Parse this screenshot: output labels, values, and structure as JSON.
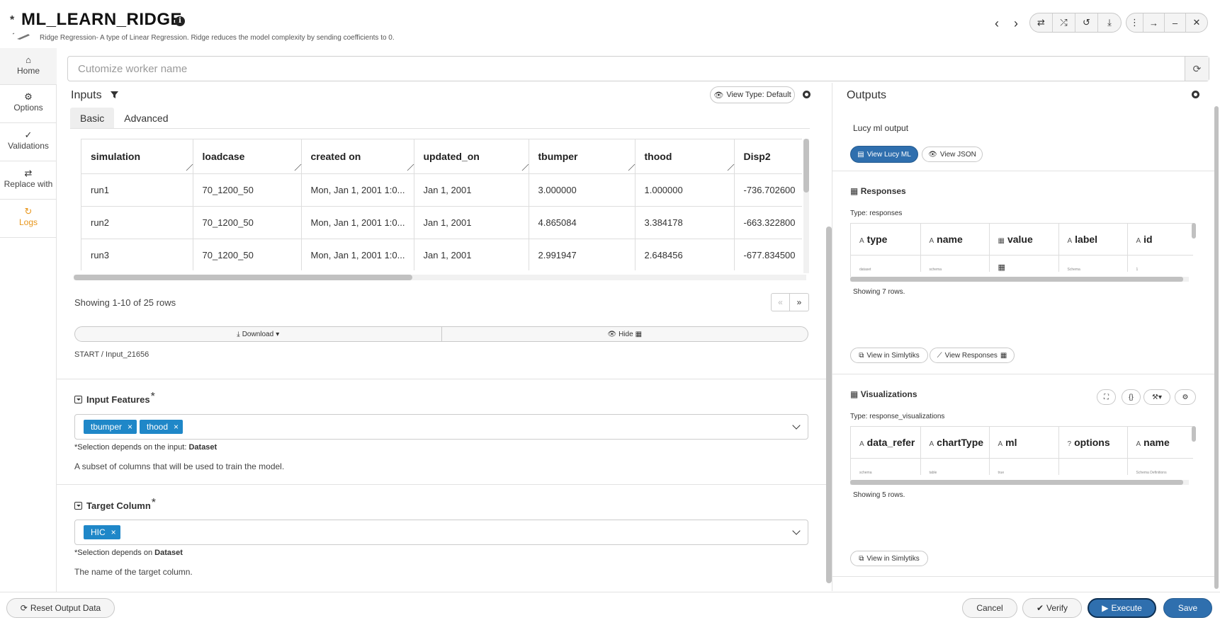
{
  "header": {
    "modified_marker": "*",
    "title": "ML_LEARN_RIDGE",
    "subtitle": "Ridge Regression- A type of Linear Regression. Ridge reduces the model complexity by sending coefficients to 0."
  },
  "sidebar": {
    "items": [
      {
        "label": "Home",
        "icon": "home-icon"
      },
      {
        "label": "Options",
        "icon": "gear-icon"
      },
      {
        "label": "Validations",
        "icon": "check-icon"
      },
      {
        "label": "Replace with",
        "icon": "swap-icon"
      },
      {
        "label": "Logs",
        "icon": "history-icon",
        "color": "#e8961c"
      }
    ]
  },
  "worker": {
    "placeholder": "Cutomize worker name",
    "value": ""
  },
  "inputs": {
    "title": "Inputs",
    "view_type": "View Type: Default",
    "tabs": [
      "Basic",
      "Advanced"
    ],
    "table": {
      "columns": [
        "simulation",
        "loadcase",
        "created on",
        "updated_on",
        "tbumper",
        "thood",
        "Disp2"
      ],
      "rows": [
        [
          "run1",
          "70_1200_50",
          "Mon, Jan 1, 2001 1:0...",
          "Jan 1, 2001",
          "3.000000",
          "1.000000",
          "-736.702600"
        ],
        [
          "run2",
          "70_1200_50",
          "Mon, Jan 1, 2001 1:0...",
          "Jan 1, 2001",
          "4.865084",
          "3.384178",
          "-663.322800"
        ],
        [
          "run3",
          "70_1200_50",
          "Mon, Jan 1, 2001 1:0...",
          "Jan 1, 2001",
          "2.991947",
          "2.648456",
          "-677.834500"
        ]
      ]
    },
    "showing": "Showing 1-10 of 25 rows",
    "pager": {
      "prev": "«",
      "next": "»"
    },
    "download_label": "Download",
    "hide_label": "Hide",
    "breadcrumb": "START  /  Input_21656",
    "input_features": {
      "title": "Input Features",
      "required": "*",
      "chips": [
        "tbumper",
        "thood"
      ],
      "note_prefix": "*Selection depends on the input: ",
      "note_bold": "Dataset",
      "description": "A subset of columns that will be used to train the model."
    },
    "target_column": {
      "title": "Target Column",
      "required": "*",
      "chips": [
        "HIC"
      ],
      "note_prefix": "*Selection depends on ",
      "note_bold": "Dataset",
      "description": "The name of the target column."
    }
  },
  "outputs": {
    "title": "Outputs",
    "lucy_label": "Lucy ml output",
    "view_lucy": "View Lucy ML",
    "view_json": "View JSON",
    "responses": {
      "title": "Responses",
      "type": "Type: responses",
      "columns": [
        "type",
        "name",
        "value",
        "label",
        "id"
      ],
      "row": [
        "dataset",
        "schema",
        "",
        "Schema",
        "1"
      ],
      "showing": "Showing 7 rows.",
      "view_simlytiks": "View in Simlytiks",
      "view_responses": "View Responses"
    },
    "visualizations": {
      "title": "Visualizations",
      "type": "Type: response_visualizations",
      "columns": [
        "data_refer",
        "chartType",
        "ml",
        "options",
        "name"
      ],
      "row": [
        "schema",
        "table",
        "true",
        "",
        "Schema Definitions"
      ],
      "showing": "Showing 5 rows.",
      "view_simlytiks": "View in Simlytiks"
    }
  },
  "footer": {
    "reset": "Reset Output Data",
    "cancel": "Cancel",
    "verify": "Verify",
    "execute": "Execute",
    "save": "Save"
  },
  "colors": {
    "accent": "#2f6fae",
    "chip": "#1f87c8",
    "logs": "#e8961c"
  }
}
